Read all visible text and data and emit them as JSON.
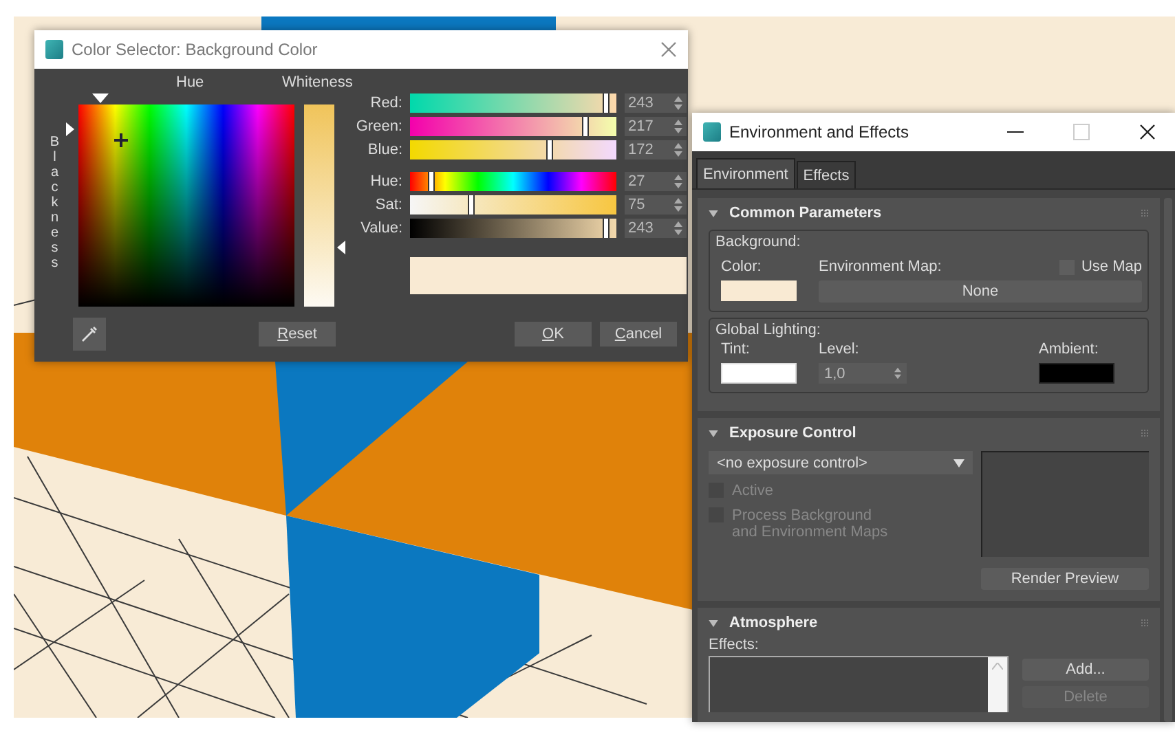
{
  "color_selector": {
    "title": "Color Selector: Background Color",
    "hue_heading": "Hue",
    "whiteness_heading": "Whiteness",
    "blackness_heading": "Blackness",
    "channels": [
      {
        "label": "Red:",
        "kind": "red",
        "level": 0.953,
        "value": "243"
      },
      {
        "label": "Green:",
        "kind": "green",
        "level": 0.851,
        "value": "217"
      },
      {
        "label": "Blue:",
        "kind": "blue",
        "level": 0.675,
        "value": "172"
      },
      {
        "label": "Hue:",
        "kind": "hue",
        "level": 0.106,
        "value": "27"
      },
      {
        "label": "Sat:",
        "kind": "sat",
        "level": 0.294,
        "value": "75"
      },
      {
        "label": "Value:",
        "kind": "value",
        "level": 0.953,
        "value": "243"
      }
    ],
    "preview": {
      "color": "#f9ead3"
    },
    "reset_button": "Reset",
    "ok_button": "OK",
    "cancel_button": "Cancel"
  },
  "environment": {
    "title": "Environment and Effects",
    "tabs": [
      {
        "label": "Environment",
        "selected": true
      },
      {
        "label": "Effects",
        "selected": false
      }
    ],
    "common": {
      "heading": "Common Parameters",
      "expanded": true,
      "background_group": "Background:",
      "color_label": "Color:",
      "background_swatch": {
        "color": "#f9ead3"
      },
      "map_label": "Environment Map:",
      "use_map": {
        "label": "Use Map",
        "checked": false
      },
      "map_button": "None",
      "lighting_group": "Global Lighting:",
      "tint_label": "Tint:",
      "tint_swatch": {
        "color": "#ffffff"
      },
      "level_label": "Level:",
      "level_value": "1,0",
      "ambient_label": "Ambient:",
      "ambient_swatch": {
        "color": "#000000"
      }
    },
    "exposure": {
      "heading": "Exposure Control",
      "expanded": true,
      "dropdown": "<no exposure control>",
      "options": [
        {
          "label": "Active",
          "checked": false,
          "disabled": true
        },
        {
          "label": "Process Background\nand Environment Maps",
          "checked": false,
          "disabled": true
        }
      ],
      "preview_button": "Render Preview"
    },
    "atmosphere": {
      "heading": "Atmosphere",
      "expanded": true,
      "effects_label": "Effects:",
      "add_button": {
        "label": "Add...",
        "disabled": false
      },
      "delete_button": {
        "label": "Delete",
        "disabled": true
      }
    }
  }
}
